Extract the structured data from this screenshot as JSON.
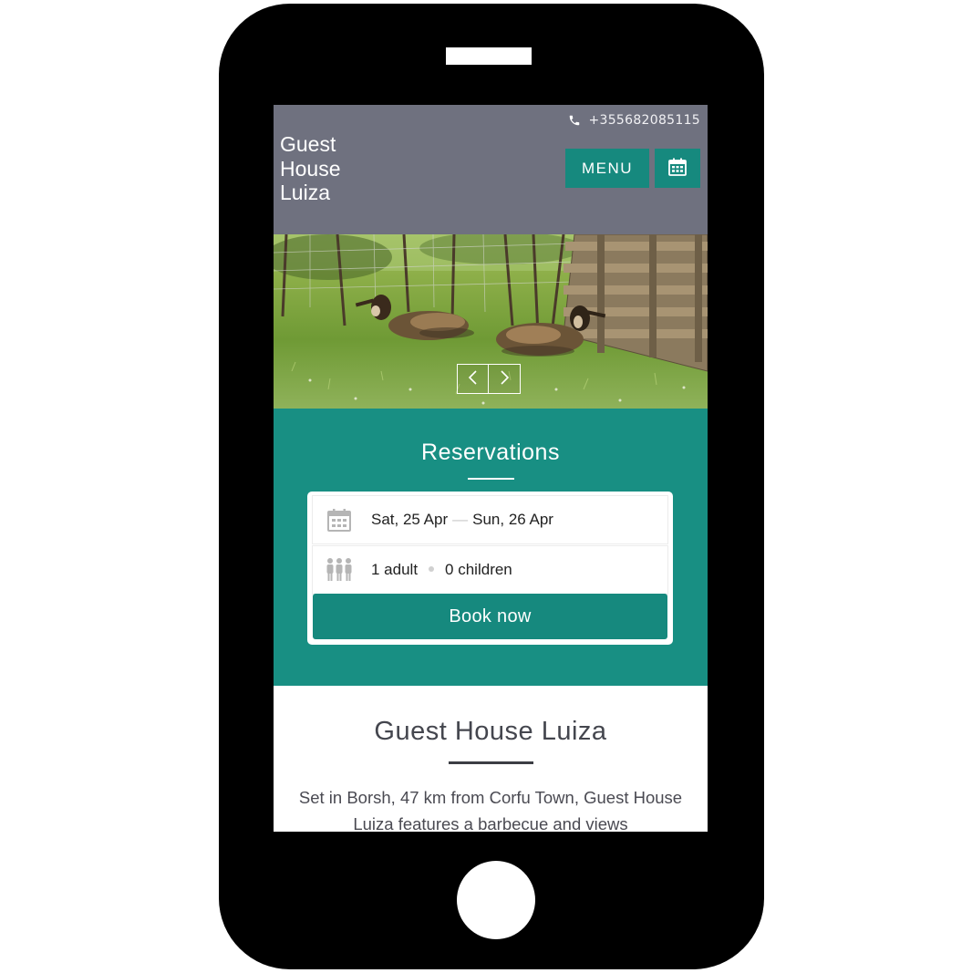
{
  "header": {
    "phone_number": "+355682085115",
    "brand_lines": [
      "Guest",
      "House",
      "Luiza"
    ],
    "menu_label": "MENU",
    "phone_icon": "phone-icon",
    "calendar_icon": "calendar-icon",
    "background": "#6f717f",
    "accent": "#16897e"
  },
  "hero": {
    "image": "goats-resting-in-grass-photo",
    "prev_icon": "chevron-left-icon",
    "next_icon": "chevron-right-icon"
  },
  "reservations": {
    "title": "Reservations",
    "check_in": "Sat, 25 Apr",
    "check_out": "Sun, 26 Apr",
    "adults": "1 adult",
    "children": "0 children",
    "date_icon": "calendar-icon",
    "guests_icon": "people-icon",
    "book_label": "Book now",
    "background": "#188f83"
  },
  "about": {
    "title": "Guest House Luiza",
    "text": "Set in Borsh, 47 km from Corfu Town, Guest House Luiza features a barbecue and views"
  }
}
